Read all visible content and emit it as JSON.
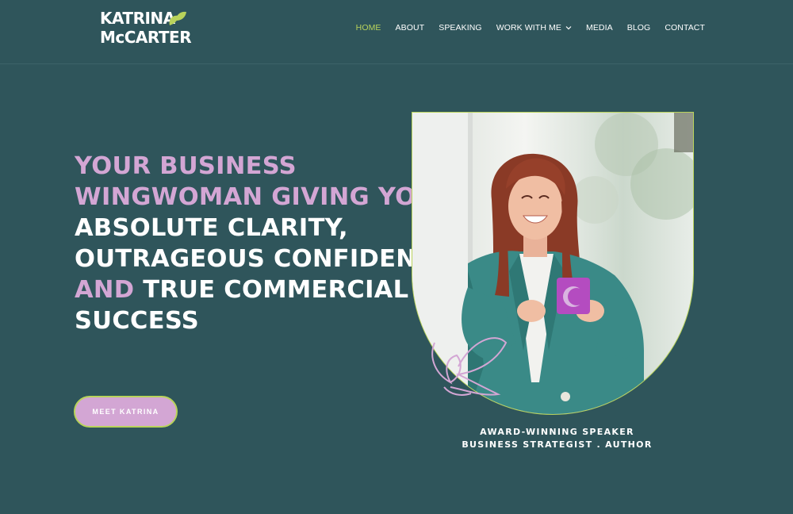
{
  "brand": {
    "logo_line1": "KATRINA",
    "logo_line2": "McCARTER",
    "logo_leaf_icon": "leaf-icon",
    "colors": {
      "background": "#2f555b",
      "accent_green": "#b9d35b",
      "accent_pink": "#d3a6d4"
    }
  },
  "nav": {
    "items": [
      {
        "label": "HOME",
        "active": true
      },
      {
        "label": "ABOUT"
      },
      {
        "label": "SPEAKING"
      },
      {
        "label": "WORK WITH ME",
        "dropdown_icon": "chevron-down-icon"
      },
      {
        "label": "MEDIA"
      },
      {
        "label": "BLOG"
      },
      {
        "label": "CONTACT"
      }
    ]
  },
  "hero": {
    "line1": "YOUR BUSINESS",
    "line2": "WINGWOMAN GIVING YOU",
    "line3": "ABSOLUTE CLARITY,",
    "line4": "OUTRAGEOUS CONFIDENCE",
    "line5_and": "AND",
    "line5_rest": " TRUE COMMERCIAL",
    "line6": "SUCCESS",
    "cta_label": "MEET KATRINA"
  },
  "portrait": {
    "doodle_icon": "heart-doodle-icon"
  },
  "caption": {
    "line1": "AWARD-WINNING SPEAKER",
    "line2": "BUSINESS STRATEGIST . AUTHOR"
  }
}
